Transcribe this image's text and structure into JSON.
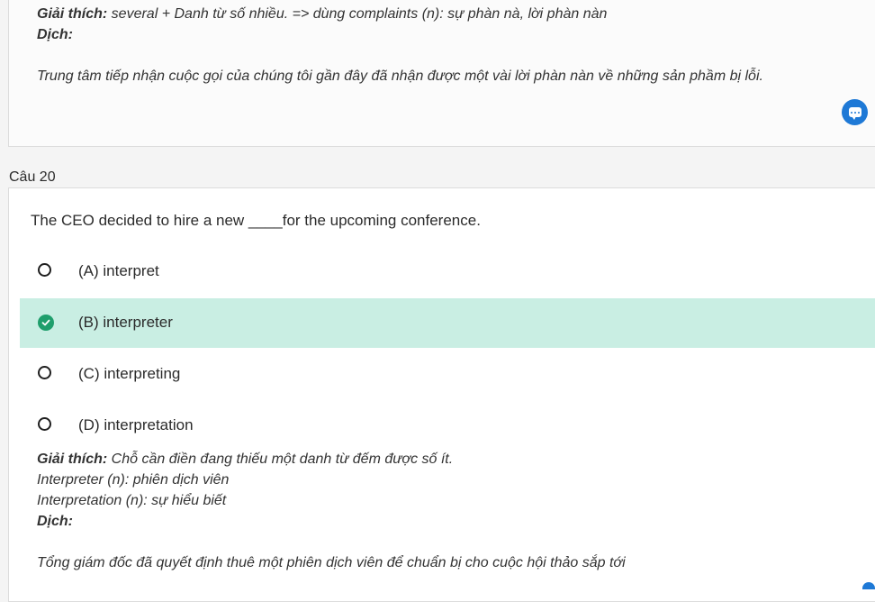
{
  "prev_card": {
    "explanation_label": "Giải thích:",
    "explanation_text": " several + Danh từ số nhiều. => dùng complaints (n): sự phàn nà, lời phàn nàn",
    "translation_label": "Dịch:",
    "translation_text": "Trung tâm tiếp nhận cuộc gọi của chúng tôi gần đây đã nhận được một vài lời phàn nàn về những sản phầm bị lỗi.",
    "chat_icon": "chat-bubble-icon"
  },
  "question": {
    "title": "Câu 20",
    "text": "The CEO decided to hire a new ____for the upcoming conference.",
    "options": [
      {
        "label": "(A) interpret",
        "selected": false
      },
      {
        "label": "(B) interpreter",
        "selected": true
      },
      {
        "label": "(C) interpreting",
        "selected": false
      },
      {
        "label": "(D) interpretation",
        "selected": false
      }
    ],
    "explanation_label": "Giải thích:",
    "explanation_text": " Chỗ cần điền đang thiếu một danh từ đếm được số ít.",
    "explanation_lines": [
      "Interpreter (n): phiên dịch viên",
      "Interpretation (n): sự hiểu biết"
    ],
    "translation_label": "Dịch:",
    "translation_text": "Tổng giám đốc đã quyết định thuê một phiên dịch viên để chuẩn bị cho cuộc hội thảo sắp tới"
  },
  "colors": {
    "selected_bg": "#c9eee3",
    "check_green": "#1f9e6c",
    "chat_blue": "#1e79d6"
  }
}
